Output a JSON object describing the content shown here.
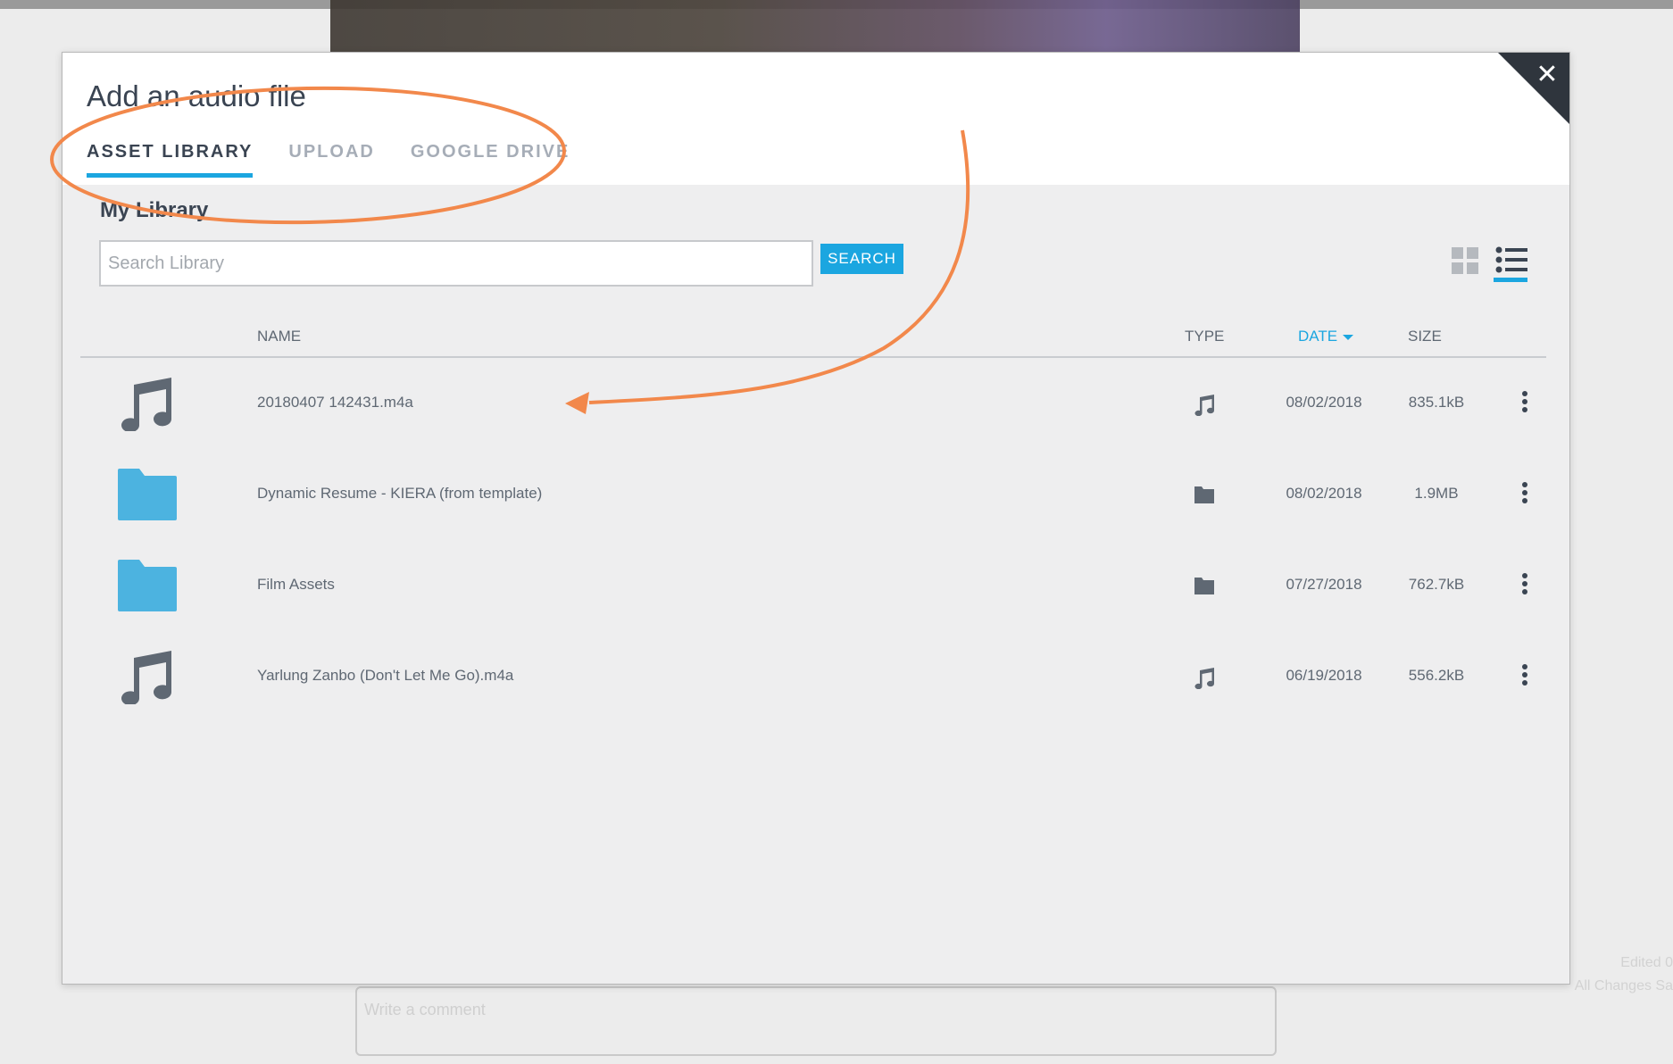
{
  "background": {
    "comment_placeholder": "Write a comment",
    "edited_line1": "Edited 0",
    "edited_line2": "All Changes Sa"
  },
  "modal": {
    "title": "Add an audio file",
    "close_icon": "close-icon",
    "tabs": [
      {
        "label": "ASSET LIBRARY",
        "active": true
      },
      {
        "label": "UPLOAD",
        "active": false
      },
      {
        "label": "GOOGLE DRIVE",
        "active": false
      }
    ],
    "library_title": "My Library",
    "search": {
      "placeholder": "Search Library",
      "value": "",
      "button_label": "SEARCH"
    },
    "view_modes": [
      "grid-view-icon",
      "list-view-icon"
    ],
    "active_view": "list",
    "columns": {
      "name": "NAME",
      "type": "TYPE",
      "date": "DATE",
      "size": "SIZE"
    },
    "sort": {
      "column": "date",
      "direction": "desc"
    },
    "rows": [
      {
        "name": "20180407 142431.m4a",
        "kind": "audio",
        "date": "08/02/2018",
        "size": "835.1kB"
      },
      {
        "name": "Dynamic Resume - KIERA (from template)",
        "kind": "folder",
        "date": "08/02/2018",
        "size": "1.9MB"
      },
      {
        "name": "Film Assets",
        "kind": "folder",
        "date": "07/27/2018",
        "size": "762.7kB"
      },
      {
        "name": "Yarlung Zanbo (Don't Let Me Go).m4a",
        "kind": "audio",
        "date": "06/19/2018",
        "size": "556.2kB"
      }
    ]
  },
  "colors": {
    "accent": "#1ba6e0",
    "folder": "#4cb3e0",
    "annotation": "#f2884b",
    "text_dark": "#3a4452",
    "text_muted": "#5f6873",
    "corner_dark": "#2f353d"
  }
}
